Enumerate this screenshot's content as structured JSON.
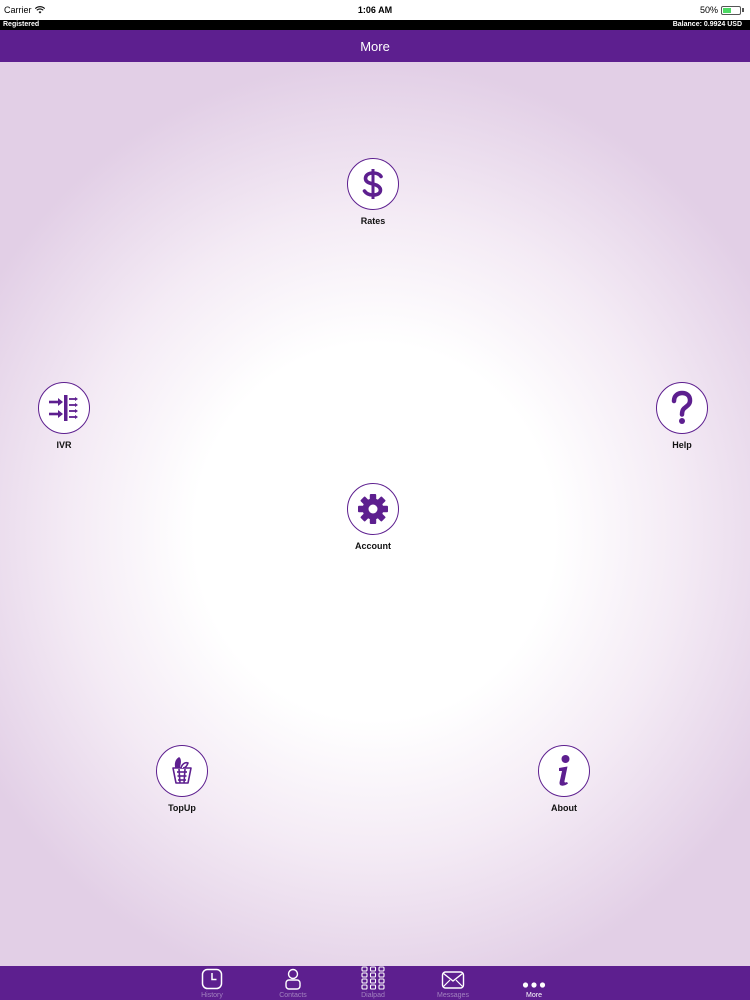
{
  "status_bar": {
    "carrier": "Carrier",
    "time": "1:06 AM",
    "battery": "50%",
    "battery_level": 0.5
  },
  "info_bar": {
    "registered": "Registered",
    "balance": "Balance: 0.9924 USD"
  },
  "nav": {
    "title": "More"
  },
  "menu": {
    "rates": "Rates",
    "ivr": "IVR",
    "help": "Help",
    "account": "Account",
    "topup": "TopUp",
    "about": "About"
  },
  "tabs": [
    {
      "label": "History"
    },
    {
      "label": "Contacts"
    },
    {
      "label": "Dialpad"
    },
    {
      "label": "Messages"
    },
    {
      "label": "More"
    }
  ],
  "colors": {
    "brand": "#5d1f8f",
    "tab_inactive": "#a383c0"
  }
}
